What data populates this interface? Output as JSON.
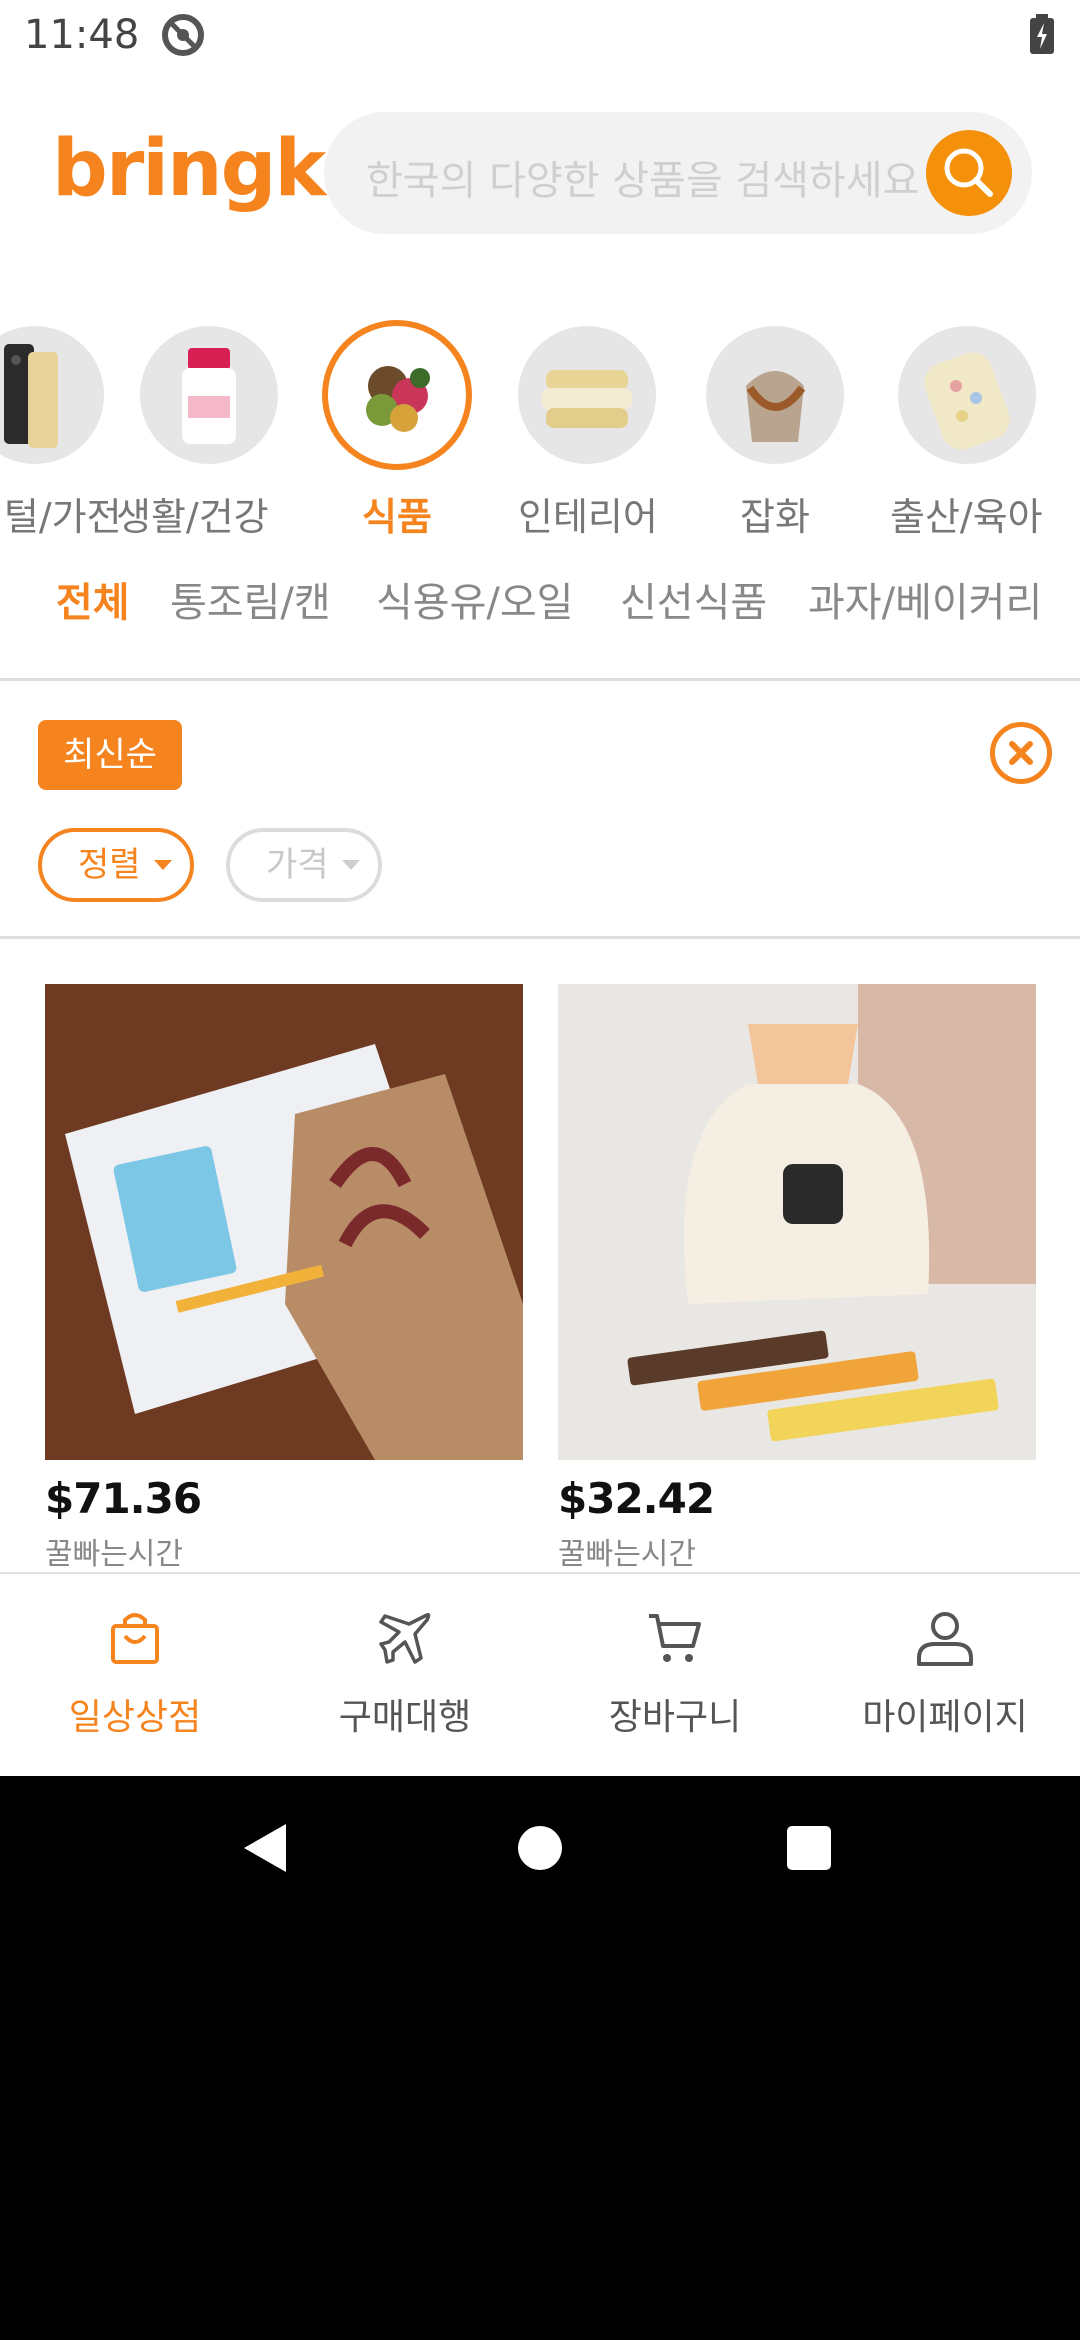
{
  "status_bar": {
    "time": "11:48"
  },
  "header": {
    "logo": "bringko",
    "search_placeholder": "한국의 다양한 상품을 검색하세요"
  },
  "categories": [
    {
      "label": "디지털/가전",
      "icon": "phone-icon",
      "active": false
    },
    {
      "label": "생활/건강",
      "icon": "supplement-bottle-icon",
      "active": false
    },
    {
      "label": "식품",
      "icon": "food-icon",
      "active": true
    },
    {
      "label": "인테리어",
      "icon": "bedding-icon",
      "active": false
    },
    {
      "label": "잡화",
      "icon": "bag-icon",
      "active": false
    },
    {
      "label": "출산/육아",
      "icon": "baby-item-icon",
      "active": false
    }
  ],
  "subcategories": [
    {
      "label": "전체",
      "active": true
    },
    {
      "label": "통조림/캔",
      "active": false
    },
    {
      "label": "식용유/오일",
      "active": false
    },
    {
      "label": "신선식품",
      "active": false
    },
    {
      "label": "과자/베이커리",
      "active": false
    }
  ],
  "filters": {
    "applied_sort": "최신순",
    "sort_label": "정렬",
    "price_label": "가격"
  },
  "products": [
    {
      "price": "$71.36",
      "brand": "꿀빠는시간"
    },
    {
      "price": "$32.42",
      "brand": "꿀빠는시간"
    }
  ],
  "bottom_nav": [
    {
      "label": "일상상점",
      "icon": "shopping-bag-icon",
      "active": true
    },
    {
      "label": "구매대행",
      "icon": "airplane-icon",
      "active": false
    },
    {
      "label": "장바구니",
      "icon": "cart-icon",
      "active": false
    },
    {
      "label": "마이페이지",
      "icon": "user-icon",
      "active": false
    }
  ],
  "colors": {
    "accent": "#f5841f",
    "search_button": "#f5900a",
    "muted_text": "#888888"
  }
}
